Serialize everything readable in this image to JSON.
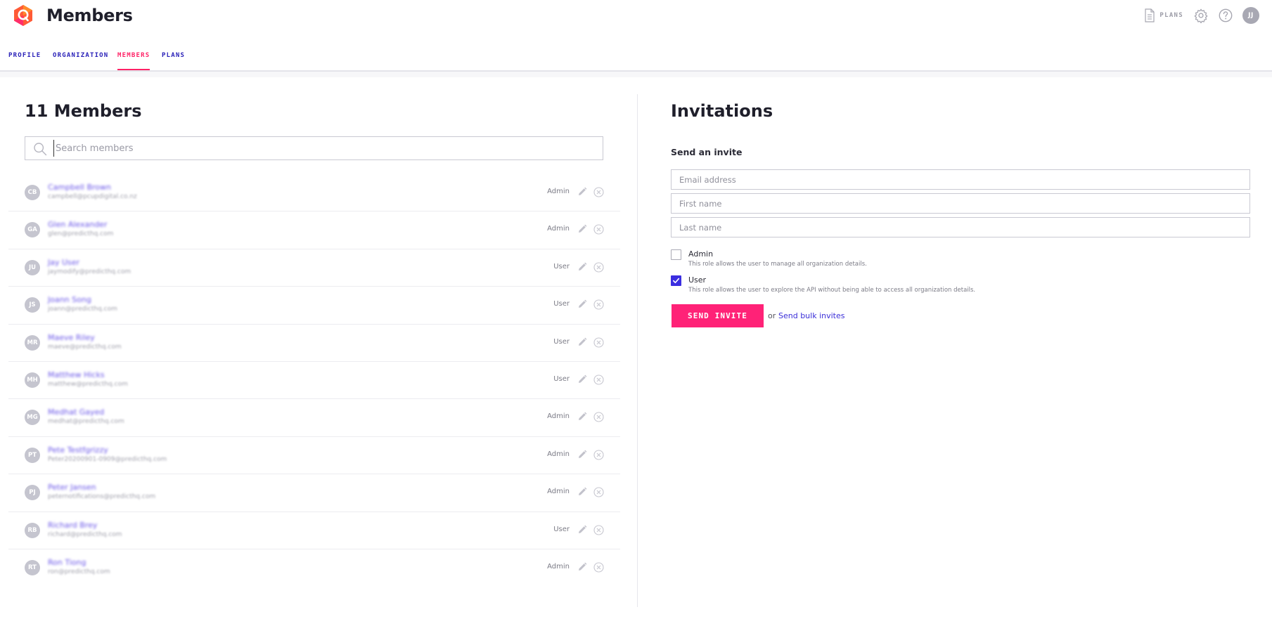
{
  "header": {
    "title": "Members",
    "plans_label": "PLANS",
    "icons": [
      "document-icon",
      "gear-icon",
      "help-icon"
    ],
    "user_initials": "JJ"
  },
  "tabs": [
    {
      "label": "PROFILE",
      "active": false
    },
    {
      "label": "ORGANIZATION",
      "active": false
    },
    {
      "label": "MEMBERS",
      "active": true
    },
    {
      "label": "PLANS",
      "active": false
    }
  ],
  "members_panel": {
    "title": "11 Members",
    "search_placeholder": "Search members",
    "members": [
      {
        "initials": "CB",
        "name": "Campbell Brown",
        "email": "campbell@pcupdigital.co.nz",
        "role": "Admin"
      },
      {
        "initials": "GA",
        "name": "Glen Alexander",
        "email": "glen@predicthq.com",
        "role": "Admin"
      },
      {
        "initials": "JU",
        "name": "Jay User",
        "email": "jaymodify@predicthq.com",
        "role": "User"
      },
      {
        "initials": "JS",
        "name": "Joann Song",
        "email": "joann@predicthq.com",
        "role": "User"
      },
      {
        "initials": "MR",
        "name": "Maeve Riley",
        "email": "maeve@predicthq.com",
        "role": "User"
      },
      {
        "initials": "MH",
        "name": "Matthew Hicks",
        "email": "matthew@predicthq.com",
        "role": "User"
      },
      {
        "initials": "MG",
        "name": "Medhat Gayed",
        "email": "medhat@predicthq.com",
        "role": "Admin"
      },
      {
        "initials": "PT",
        "name": "Pete Testfgrizzy",
        "email": "Peter20200901-0909@predicthq.com",
        "role": "Admin"
      },
      {
        "initials": "PJ",
        "name": "Peter Jansen",
        "email": "peternotifications@predicthq.com",
        "role": "Admin"
      },
      {
        "initials": "RB",
        "name": "Richard Brey",
        "email": "richard@predicthq.com",
        "role": "User"
      },
      {
        "initials": "RT",
        "name": "Ron Tiong",
        "email": "ron@predicthq.com",
        "role": "Admin"
      }
    ]
  },
  "invitations": {
    "title": "Invitations",
    "send_title": "Send an invite",
    "email_placeholder": "Email address",
    "first_name_placeholder": "First name",
    "last_name_placeholder": "Last name",
    "roles": [
      {
        "label": "Admin",
        "description": "This role allows the user to manage all organization details.",
        "checked": false
      },
      {
        "label": "User",
        "description": "This role allows the user to explore the API without being able to access all organization details.",
        "checked": true
      }
    ],
    "send_button": "SEND INVITE",
    "or_text": "or",
    "bulk_link": "Send bulk invites"
  },
  "colors": {
    "accent_pink": "#ff2277",
    "link_purple": "#3a2ed8",
    "tab_blue": "#2a21b8"
  }
}
